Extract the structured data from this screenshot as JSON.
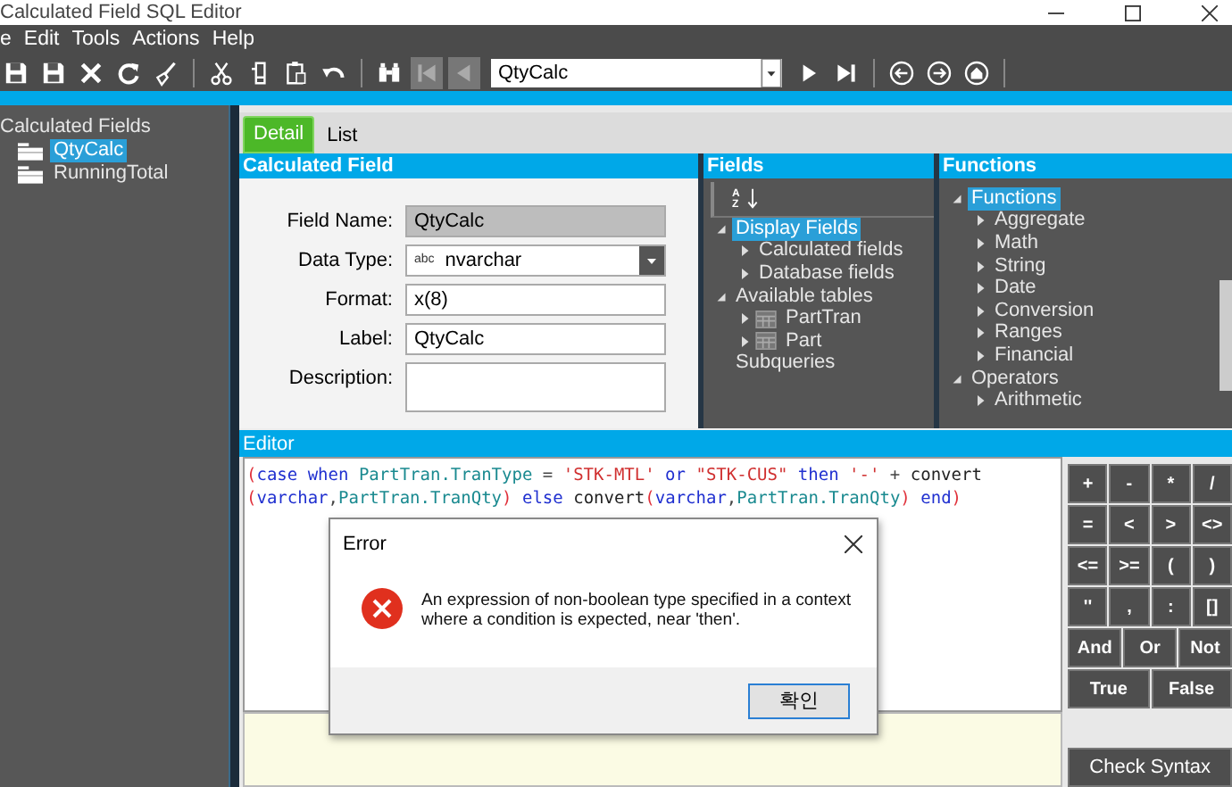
{
  "window": {
    "title": "Calculated Field SQL Editor"
  },
  "menu": [
    "e",
    "Edit",
    "Tools",
    "Actions",
    "Help"
  ],
  "toolbar": {
    "left_groups": [
      [
        {
          "kind": "save",
          "disabled": false
        },
        {
          "kind": "save",
          "disabled": false
        },
        {
          "kind": "close",
          "disabled": false
        },
        {
          "kind": "refresh",
          "disabled": false
        },
        {
          "kind": "brush",
          "disabled": false
        }
      ],
      [
        {
          "kind": "cut",
          "disabled": false
        },
        {
          "kind": "copy",
          "disabled": false
        },
        {
          "kind": "paste",
          "disabled": false
        },
        {
          "kind": "undo",
          "disabled": false
        }
      ],
      [
        {
          "kind": "find",
          "disabled": false
        },
        {
          "kind": "first",
          "disabled": true
        },
        {
          "kind": "prev",
          "disabled": true
        }
      ]
    ],
    "record_combo": {
      "value": "QtyCalc"
    },
    "right_groups": [
      [
        {
          "kind": "next",
          "disabled": false
        },
        {
          "kind": "last",
          "disabled": false
        }
      ],
      [
        {
          "kind": "back",
          "disabled": false
        },
        {
          "kind": "forward",
          "disabled": false
        },
        {
          "kind": "home",
          "disabled": false
        }
      ]
    ]
  },
  "left_tree": [
    {
      "label": "Calculated Fields",
      "selected": false,
      "children": [
        {
          "label": "QtyCalc",
          "selected": true
        },
        {
          "label": "RunningTotal",
          "selected": false
        }
      ]
    }
  ],
  "tabs": [
    {
      "label": "Detail",
      "selected": true
    },
    {
      "label": "List",
      "selected": false
    }
  ],
  "calculated_field": {
    "title": "Calculated Field",
    "fields": [
      {
        "kind": "text",
        "label": "Field Name:",
        "value": "QtyCalc",
        "disabled": true
      },
      {
        "kind": "dropdown",
        "label": "Data Type:",
        "badge": "abc",
        "value": "nvarchar",
        "disabled": false
      },
      {
        "kind": "text",
        "label": "Format:",
        "value": "x(8)",
        "disabled": false
      },
      {
        "kind": "text",
        "label": "Label:",
        "value": "QtyCalc",
        "disabled": false
      },
      {
        "kind": "textarea",
        "label": "Description:",
        "disabled": false
      }
    ]
  },
  "fields_panel": {
    "title": "Fields",
    "sort_letters": [
      "A",
      "Z"
    ],
    "tree": [
      {
        "label": "Display Fields",
        "kind": "group",
        "expanded": true,
        "selected": true,
        "children": [
          {
            "label": "Calculated fields",
            "kind": "group",
            "expanded": false,
            "selected": false
          },
          {
            "label": "Database fields",
            "kind": "group",
            "expanded": false,
            "selected": false
          }
        ]
      },
      {
        "label": "Available tables",
        "kind": "group",
        "expanded": true,
        "selected": false,
        "children": [
          {
            "label": "PartTran",
            "kind": "table",
            "expanded": false,
            "selected": false
          },
          {
            "label": "Part",
            "kind": "table",
            "expanded": false,
            "selected": false
          }
        ]
      },
      {
        "label": "Subqueries",
        "kind": "leaf",
        "selected": false
      }
    ]
  },
  "functions_panel": {
    "title": "Functions",
    "tree": [
      {
        "label": "Functions",
        "kind": "group",
        "expanded": true,
        "selected": true,
        "children": [
          {
            "label": "Aggregate",
            "kind": "group",
            "expanded": false,
            "selected": false
          },
          {
            "label": "Math",
            "kind": "group",
            "expanded": false,
            "selected": false
          },
          {
            "label": "String",
            "kind": "group",
            "expanded": false,
            "selected": false
          },
          {
            "label": "Date",
            "kind": "group",
            "expanded": false,
            "selected": false
          },
          {
            "label": "Conversion",
            "kind": "group",
            "expanded": false,
            "selected": false
          },
          {
            "label": "Ranges",
            "kind": "group",
            "expanded": false,
            "selected": false
          },
          {
            "label": "Financial",
            "kind": "group",
            "expanded": false,
            "selected": false
          }
        ]
      },
      {
        "label": "Operators",
        "kind": "group",
        "expanded": true,
        "selected": false,
        "children": [
          {
            "label": "Arithmetic",
            "kind": "group",
            "expanded": false,
            "selected": false
          }
        ]
      }
    ]
  },
  "editor": {
    "title": "Editor",
    "code_lines": [
      [
        {
          "text": "(",
          "kind": "paren"
        },
        {
          "text": "case when ",
          "kind": "keyword"
        },
        {
          "text": "PartTran.TranType",
          "kind": "ident"
        },
        {
          "text": " = ",
          "kind": "op"
        },
        {
          "text": "'STK-MTL'",
          "kind": "string"
        },
        {
          "text": " or ",
          "kind": "keyword"
        },
        {
          "text": "\"STK-CUS\"",
          "kind": "string"
        },
        {
          "text": " then ",
          "kind": "keyword"
        },
        {
          "text": "'-'",
          "kind": "string"
        },
        {
          "text": " + ",
          "kind": "op"
        },
        {
          "text": "convert",
          "kind": "func"
        }
      ],
      [
        {
          "text": "(",
          "kind": "paren"
        },
        {
          "text": "varchar",
          "kind": "keyword"
        },
        {
          "text": ",",
          "kind": "op"
        },
        {
          "text": "PartTran.TranQty",
          "kind": "ident"
        },
        {
          "text": ")",
          "kind": "paren"
        },
        {
          "text": " else ",
          "kind": "keyword"
        },
        {
          "text": "convert",
          "kind": "func"
        },
        {
          "text": "(",
          "kind": "paren"
        },
        {
          "text": "varchar",
          "kind": "keyword"
        },
        {
          "text": ",",
          "kind": "op"
        },
        {
          "text": "PartTran.TranQty",
          "kind": "ident"
        },
        {
          "text": ")",
          "kind": "paren"
        },
        {
          "text": " end",
          "kind": "keyword"
        },
        {
          "text": ")",
          "kind": "paren"
        }
      ]
    ],
    "keypad": [
      [
        "+",
        "-",
        "*",
        "/"
      ],
      [
        "=",
        "<",
        ">",
        "<>"
      ],
      [
        "<=",
        ">=",
        "(",
        ")"
      ],
      [
        "''",
        ",",
        ":",
        "[]"
      ],
      [
        "And",
        "Or",
        "Not"
      ],
      [
        "True",
        "False"
      ]
    ],
    "check_button": "Check Syntax"
  },
  "dialog": {
    "title": "Error",
    "message": "An expression of non-boolean type specified in a context where a condition is expected, near 'then'.",
    "button": "확인"
  }
}
